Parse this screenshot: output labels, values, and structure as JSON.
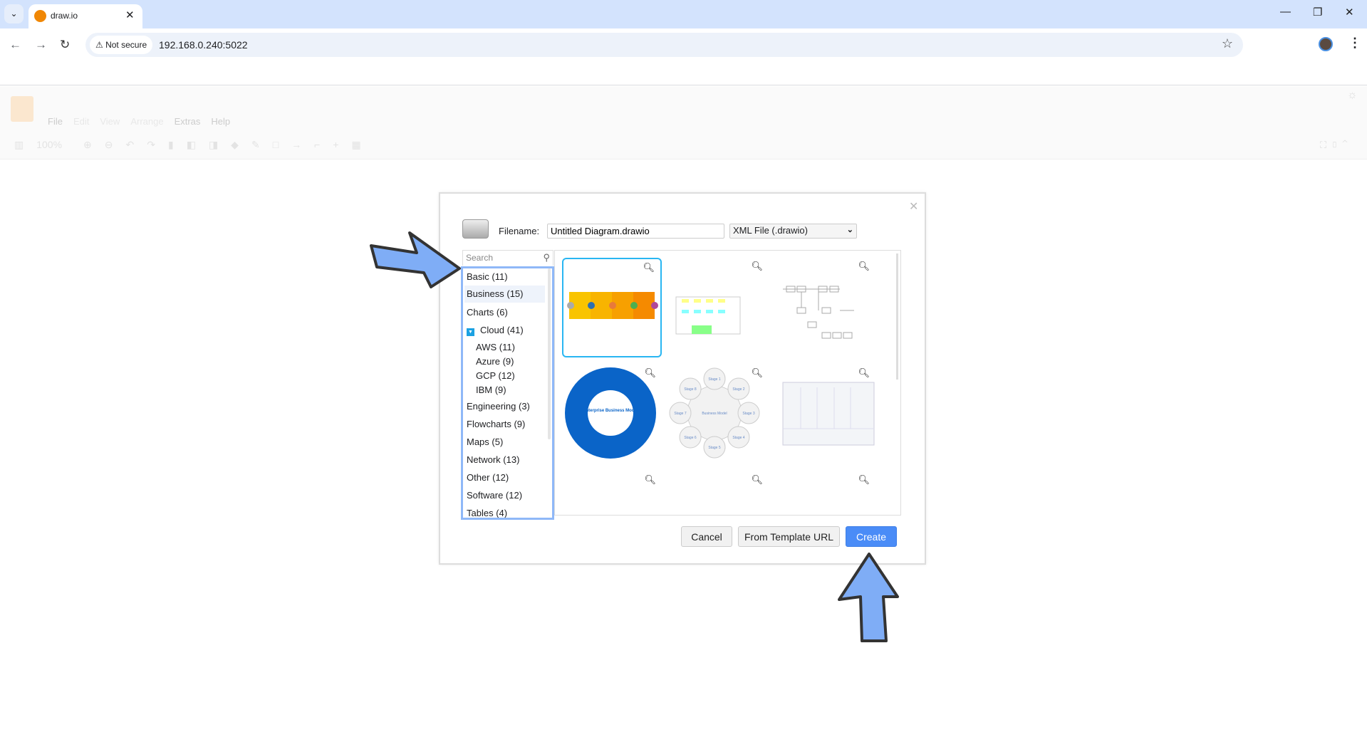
{
  "browser": {
    "tab_title": "draw.io",
    "not_secure": "Not secure",
    "url": "192.168.0.240:5022"
  },
  "app": {
    "menu": [
      "File",
      "Edit",
      "View",
      "Arrange",
      "Extras",
      "Help"
    ],
    "zoom": "100%"
  },
  "dialog": {
    "filename_label": "Filename:",
    "filename_value": "Untitled Diagram.drawio",
    "format_selected": "XML File (.drawio)",
    "search_placeholder": "Search",
    "categories": [
      {
        "label": "Basic (11)"
      },
      {
        "label": "Business (15)",
        "selected": true
      },
      {
        "label": "Charts (6)"
      },
      {
        "label": "Cloud (41)",
        "expanded": true
      },
      {
        "label": "AWS (11)"
      },
      {
        "label": "Azure (9)"
      },
      {
        "label": "GCP (12)"
      },
      {
        "label": "IBM (9)"
      },
      {
        "label": "Engineering (3)"
      },
      {
        "label": "Flowcharts (9)"
      },
      {
        "label": "Maps (5)"
      },
      {
        "label": "Network (13)"
      },
      {
        "label": "Other (12)"
      },
      {
        "label": "Software (12)"
      },
      {
        "label": "Tables (4)"
      }
    ],
    "thumb_text": {
      "enterprise": "Enterprise Business Model",
      "circle_center": "Business Model",
      "stages": [
        "Stage 1",
        "Stage 2",
        "Stage 3",
        "Stage 4",
        "Stage 5",
        "Stage 6",
        "Stage 7",
        "Stage 8"
      ]
    },
    "buttons": {
      "cancel": "Cancel",
      "template_url": "From Template URL",
      "create": "Create"
    },
    "colors": {
      "accent": "#4a8cf7",
      "selection": "#29b6f2",
      "annotation_arrow": "#7fadf6"
    }
  }
}
